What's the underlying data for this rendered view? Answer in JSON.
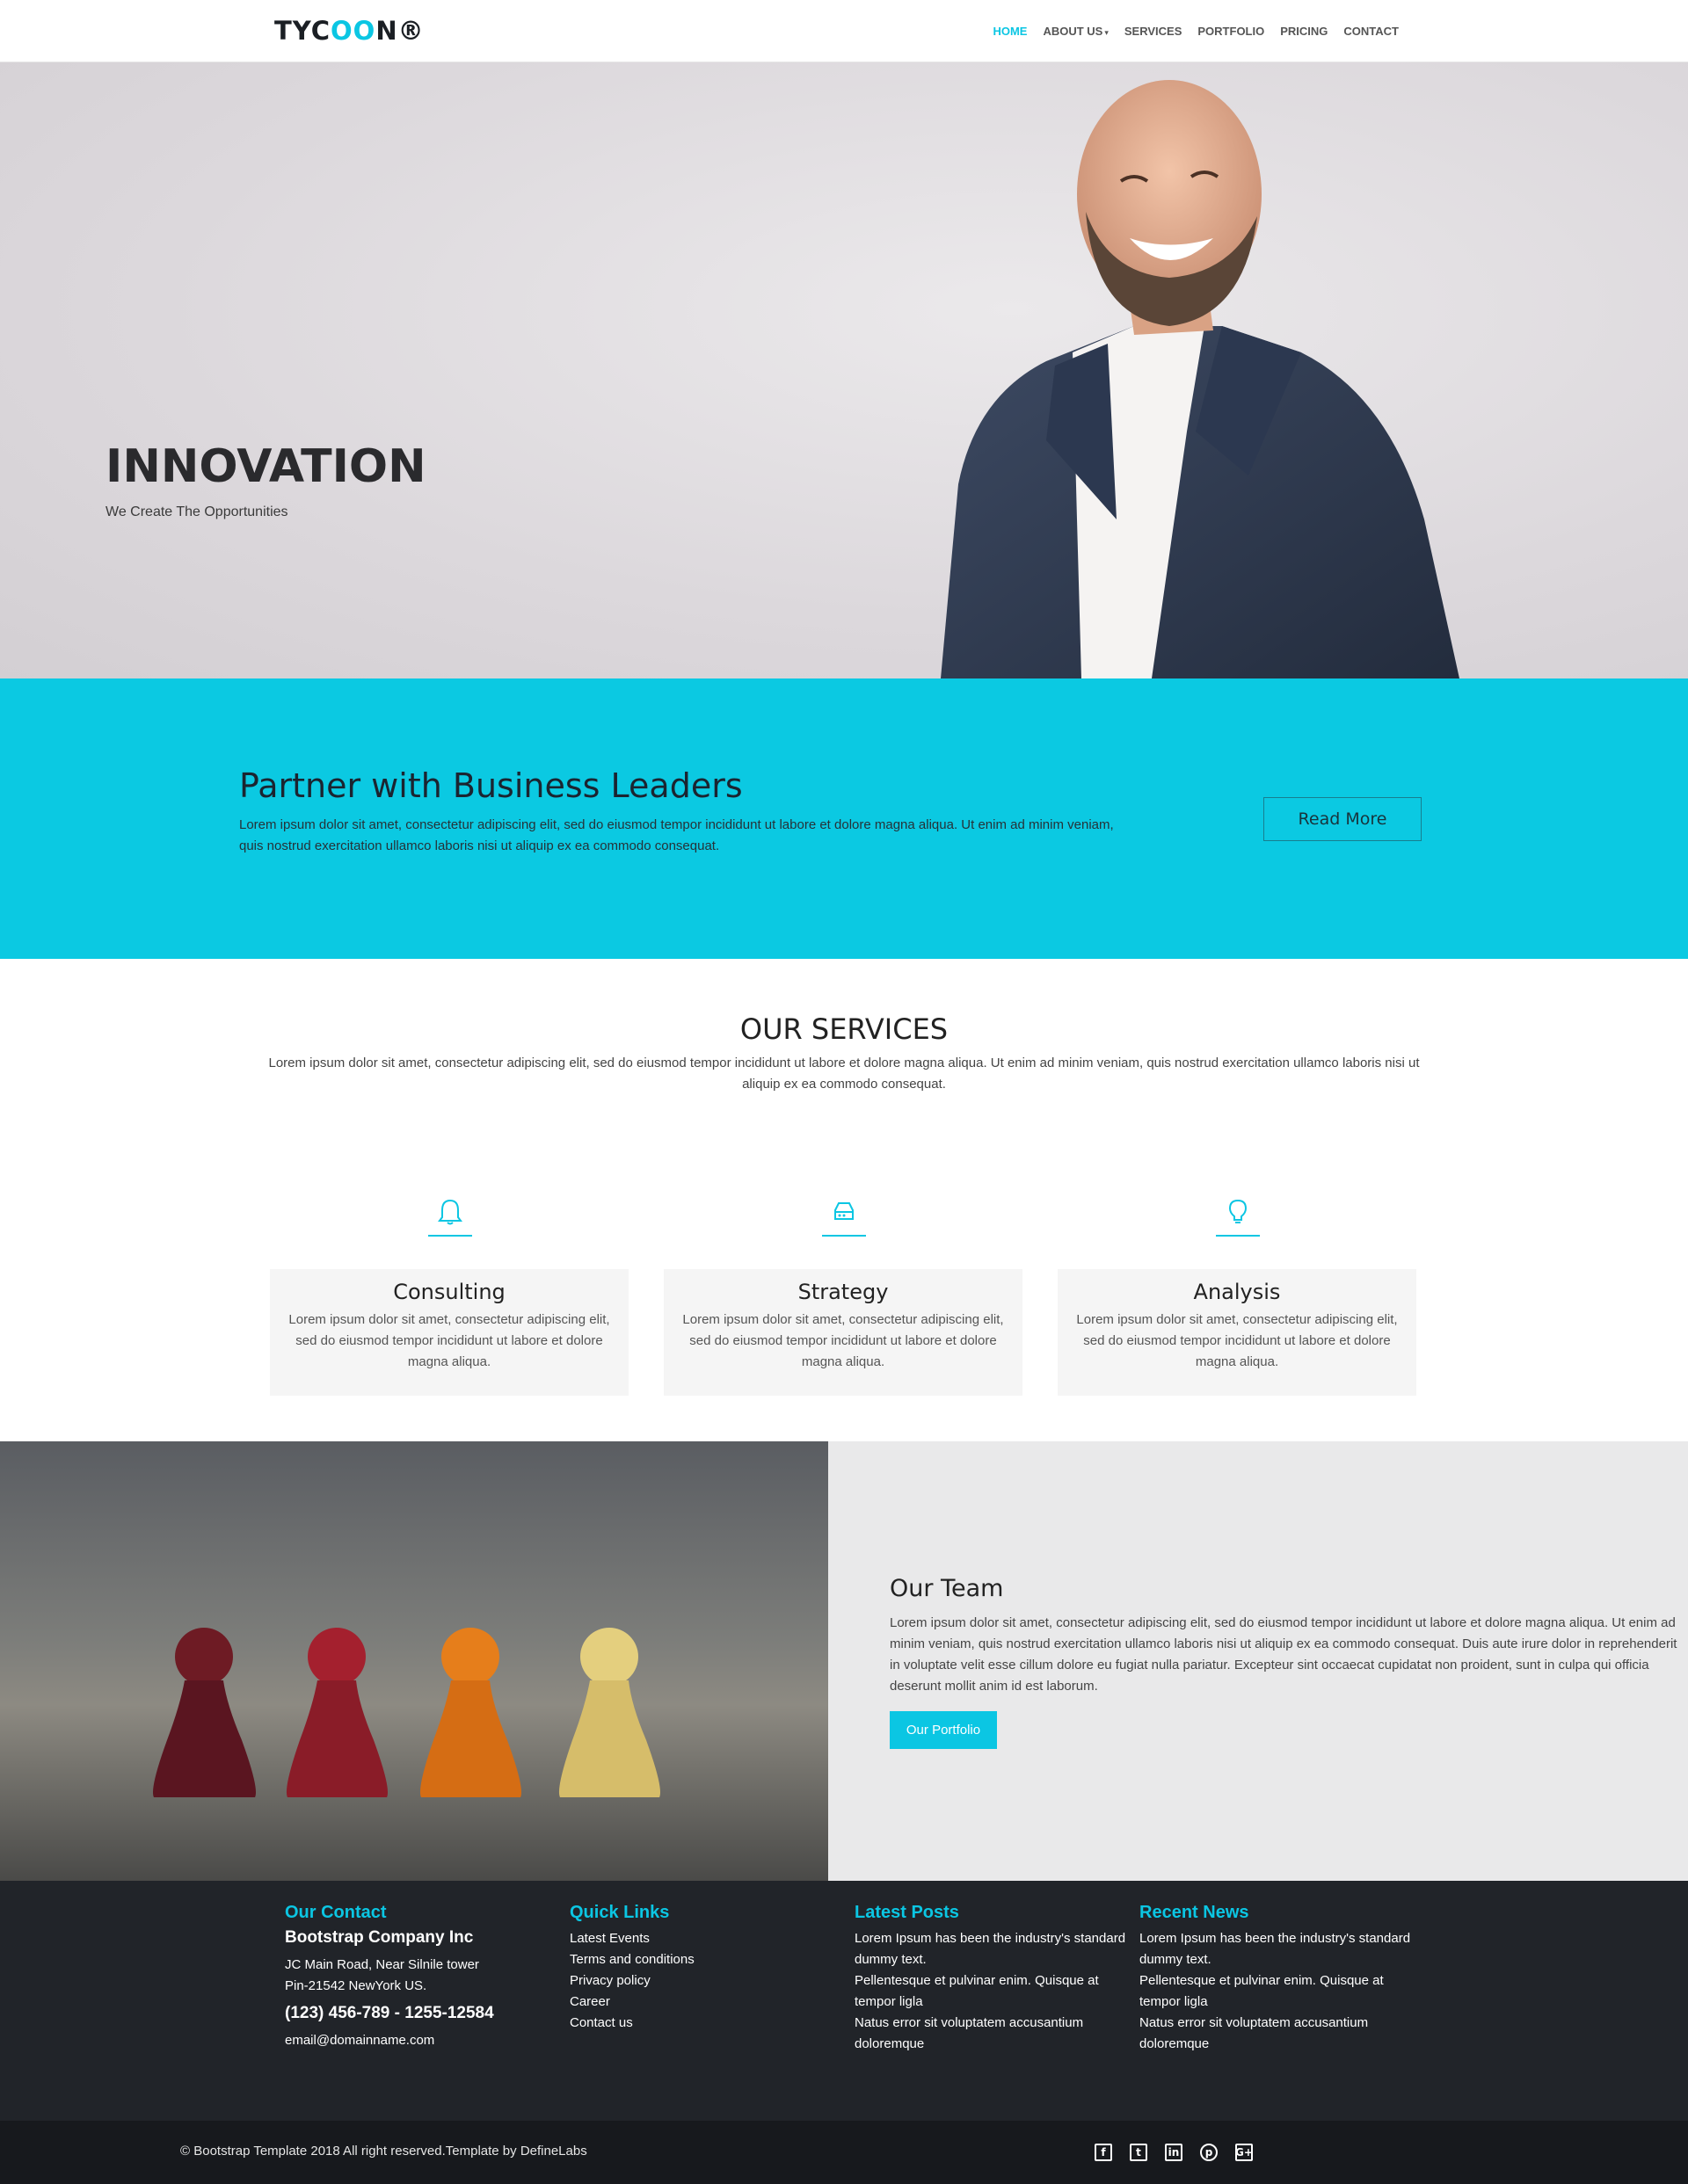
{
  "brand": {
    "prefix": "TYC",
    "accent": "OO",
    "suffix": "N",
    "mark": "®"
  },
  "nav": {
    "items": [
      {
        "label": "HOME",
        "active": true
      },
      {
        "label": "ABOUT US",
        "dropdown": true
      },
      {
        "label": "SERVICES"
      },
      {
        "label": "PORTFOLIO"
      },
      {
        "label": "PRICING"
      },
      {
        "label": "CONTACT"
      }
    ]
  },
  "hero": {
    "title": "INNOVATION",
    "subtitle": "We Create The Opportunities"
  },
  "cta": {
    "title": "Partner with Business Leaders",
    "text": "Lorem ipsum dolor sit amet, consectetur adipiscing elit, sed do eiusmod tempor incididunt ut labore et dolore magna aliqua. Ut enim ad minim veniam, quis nostrud exercitation ullamco laboris nisi ut aliquip ex ea commodo consequat.",
    "button": "Read More"
  },
  "services": {
    "title": "OUR SERVICES",
    "description": "Lorem ipsum dolor sit amet, consectetur adipiscing elit, sed do eiusmod tempor incididunt ut labore et dolore magna aliqua. Ut enim ad minim veniam, quis nostrud exercitation ullamco laboris nisi ut aliquip ex ea commodo consequat.",
    "items": [
      {
        "icon": "bell-icon",
        "title": "Consulting",
        "text": "Lorem ipsum dolor sit amet, consectetur adipiscing elit, sed do eiusmod tempor incididunt ut labore et dolore magna aliqua."
      },
      {
        "icon": "hard-drive-icon",
        "title": "Strategy",
        "text": "Lorem ipsum dolor sit amet, consectetur adipiscing elit, sed do eiusmod tempor incididunt ut labore et dolore magna aliqua."
      },
      {
        "icon": "lightbulb-icon",
        "title": "Analysis",
        "text": "Lorem ipsum dolor sit amet, consectetur adipiscing elit, sed do eiusmod tempor incididunt ut labore et dolore magna aliqua."
      }
    ]
  },
  "team": {
    "title": "Our Team",
    "text": "Lorem ipsum dolor sit amet, consectetur adipiscing elit, sed do eiusmod tempor incididunt ut labore et dolore magna aliqua. Ut enim ad minim veniam, quis nostrud exercitation ullamco laboris nisi ut aliquip ex ea commodo consequat. Duis aute irure dolor in reprehenderit in voluptate velit esse cillum dolore eu fugiat nulla pariatur. Excepteur sint occaecat cupidatat non proident, sunt in culpa qui officia deserunt mollit anim id est laborum.",
    "button": "Our Portfolio"
  },
  "footer": {
    "contact": {
      "heading": "Our Contact",
      "company": "Bootstrap Company Inc",
      "address1": "JC Main Road, Near Silnile tower",
      "address2": "Pin-21542 NewYork US.",
      "phone": "(123) 456-789 - 1255-12584",
      "email": "email@domainname.com"
    },
    "links": {
      "heading": "Quick Links",
      "items": [
        "Latest Events",
        "Terms and conditions",
        "Privacy policy",
        "Career",
        "Contact us"
      ]
    },
    "posts": {
      "heading": "Latest Posts",
      "items": [
        "Lorem Ipsum has been the industry's standard dummy text.",
        "Pellentesque et pulvinar enim. Quisque at tempor ligla",
        "Natus error sit voluptatem accusantium doloremque"
      ]
    },
    "news": {
      "heading": "Recent News",
      "items": [
        "Lorem Ipsum has been the industry's standard dummy text.",
        "Pellentesque et pulvinar enim. Quisque at tempor ligla",
        "Natus error sit voluptatem accusantium doloremque"
      ]
    },
    "copyright": "© Bootstrap Template 2018 All right reserved.Template by DefineLabs",
    "social": [
      {
        "icon": "facebook-icon",
        "glyph": "f"
      },
      {
        "icon": "twitter-icon",
        "glyph": "t"
      },
      {
        "icon": "linkedin-icon",
        "glyph": "in"
      },
      {
        "icon": "pinterest-icon",
        "glyph": "p"
      },
      {
        "icon": "google-plus-icon",
        "glyph": "G+"
      }
    ]
  },
  "colors": {
    "accent": "#0bc6e3",
    "footer": "#212429",
    "bottombar": "#17191d"
  }
}
